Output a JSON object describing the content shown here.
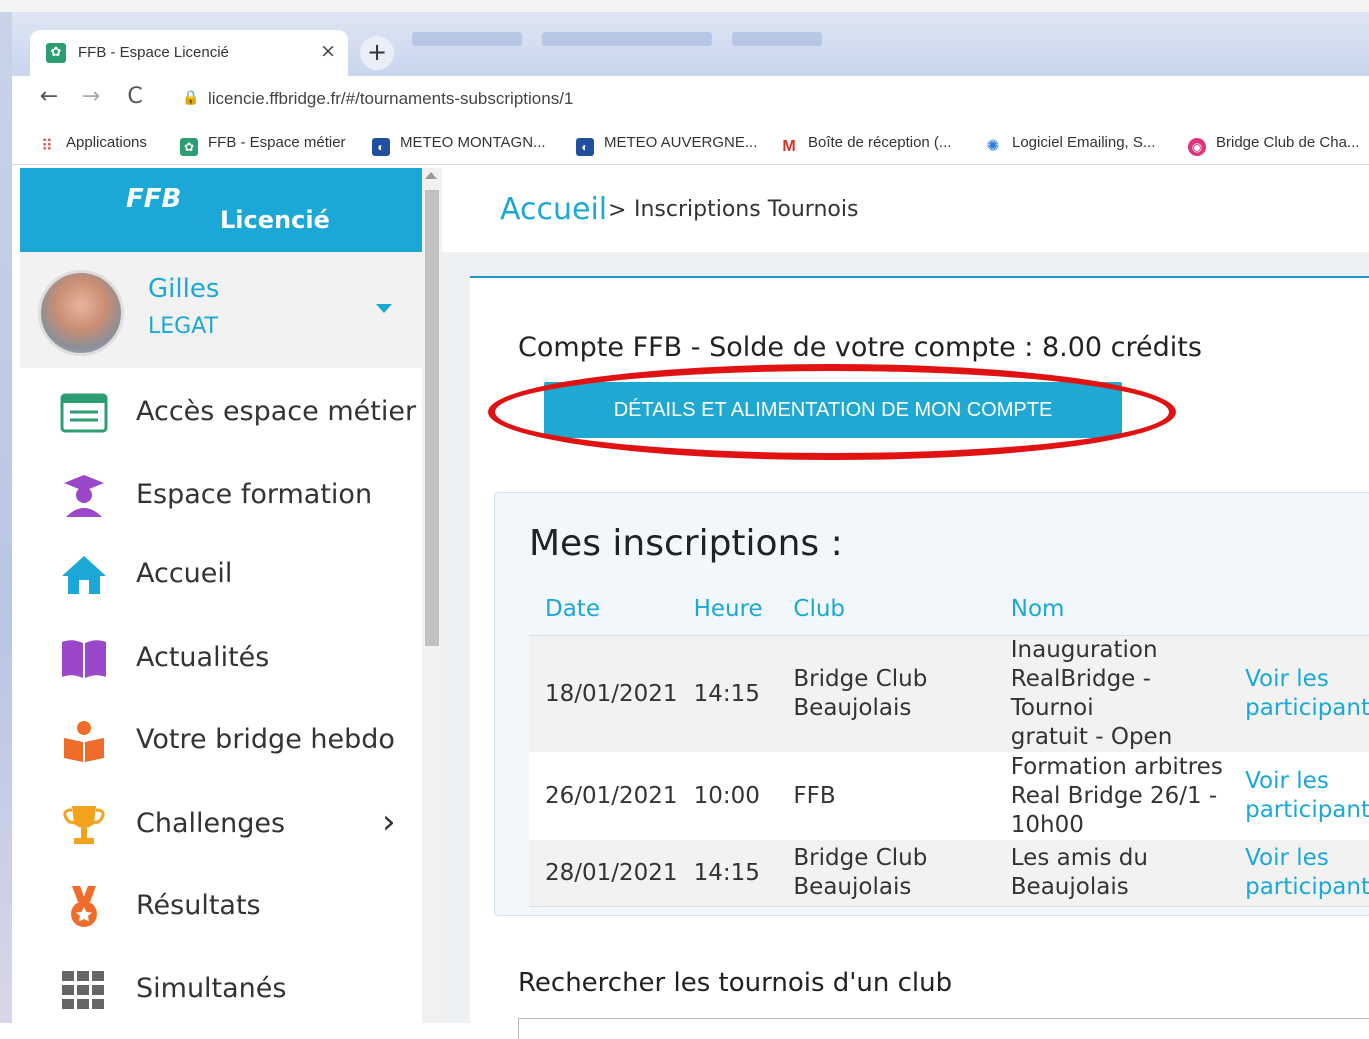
{
  "browser": {
    "tab_title": "FFB - Espace Licencié",
    "tab_close": "×",
    "new_tab": "+",
    "url": "licencie.ffbridge.fr/#/tournaments-subscriptions/1",
    "nav_back": "←",
    "nav_forward": "→",
    "nav_reload": "C",
    "bookmarks": [
      {
        "label": "Applications",
        "icon": "apps-grid-icon"
      },
      {
        "label": "FFB - Espace métier",
        "icon": "ffb-icon"
      },
      {
        "label": "METEO MONTAGN...",
        "icon": "meteo-icon"
      },
      {
        "label": "METEO AUVERGNE...",
        "icon": "meteo-icon"
      },
      {
        "label": "Boîte de réception (...",
        "icon": "gmail-icon"
      },
      {
        "label": "Logiciel Emailing, S...",
        "icon": "emailing-icon"
      },
      {
        "label": "Bridge Club de Cha...",
        "icon": "club-icon"
      }
    ]
  },
  "sidebar": {
    "brand_logo": "FFB",
    "brand_sub": "Licencié",
    "user_first": "Gilles",
    "user_last": "LEGAT",
    "items": [
      {
        "label": "Accès espace métier",
        "icon": "id-card-icon",
        "color": "#2c9e71"
      },
      {
        "label": "Espace formation",
        "icon": "graduate-icon",
        "color": "#9b47c9"
      },
      {
        "label": "Accueil",
        "icon": "home-icon",
        "color": "#1ba8d6"
      },
      {
        "label": "Actualités",
        "icon": "book-icon",
        "color": "#9b47c9"
      },
      {
        "label": "Votre bridge hebdo",
        "icon": "reader-icon",
        "color": "#ef6c2a"
      },
      {
        "label": "Challenges",
        "icon": "trophy-icon",
        "color": "#f3a21c",
        "chevron": "›"
      },
      {
        "label": "Résultats",
        "icon": "medal-icon",
        "color": "#ef6c2a"
      },
      {
        "label": "Simultanés",
        "icon": "grid-icon",
        "color": "#666666"
      }
    ]
  },
  "main": {
    "breadcrumb_home": "Accueil",
    "breadcrumb_sep": ">",
    "breadcrumb_current": "Inscriptions Tournois",
    "balance_text": "Compte FFB - Solde de votre compte :  8.00 crédits",
    "details_button": "DÉTAILS ET ALIMENTATION DE MON COMPTE",
    "subscriptions_title": "Mes inscriptions :",
    "table_headers": [
      "Date",
      "Heure",
      "Club",
      "Nom",
      ""
    ],
    "rows": [
      {
        "date": "18/01/2021",
        "time": "14:15",
        "club": [
          "Bridge Club",
          "Beaujolais"
        ],
        "name": [
          "Inauguration",
          "RealBridge - Tournoi",
          "gratuit - Open"
        ],
        "link": [
          "Voir les",
          "participant"
        ]
      },
      {
        "date": "26/01/2021",
        "time": "10:00",
        "club": [
          "FFB"
        ],
        "name": [
          "Formation arbitres",
          "Real Bridge 26/1 -",
          "10h00"
        ],
        "link": [
          "Voir les",
          "participant"
        ]
      },
      {
        "date": "28/01/2021",
        "time": "14:15",
        "club": [
          "Bridge Club",
          "Beaujolais"
        ],
        "name": [
          "Les amis du",
          "Beaujolais"
        ],
        "link": [
          "Voir les",
          "participant"
        ]
      }
    ],
    "search_title": "Rechercher les tournois d'un club"
  },
  "colors": {
    "accent": "#1ba8d6",
    "highlight_ring": "#e01212"
  }
}
